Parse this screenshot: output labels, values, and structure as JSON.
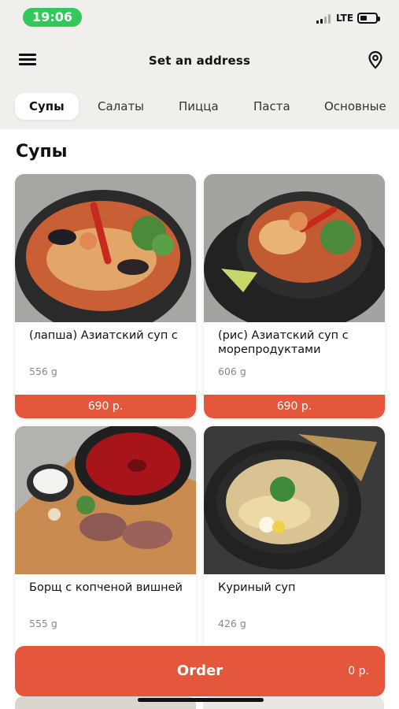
{
  "status_bar": {
    "time": "19:06",
    "network": "LTE",
    "battery_level": 0.45
  },
  "header": {
    "menu_icon": "hamburger-menu-icon",
    "title": "Set an address",
    "location_icon": "location-pin-icon"
  },
  "tabs": [
    {
      "label": "Супы",
      "active": true
    },
    {
      "label": "Салаты",
      "active": false
    },
    {
      "label": "Пицца",
      "active": false
    },
    {
      "label": "Паста",
      "active": false
    },
    {
      "label": "Основные",
      "active": false
    }
  ],
  "section": {
    "title": "Супы"
  },
  "products": [
    {
      "name": "(лапша) Азиатский суп с",
      "weight": "556 g",
      "price": "690 р."
    },
    {
      "name": "(рис) Азиатский суп с морепродуктами",
      "weight": "606 g",
      "price": "690 р."
    },
    {
      "name": "Борщ с копченой вишней",
      "weight": "555 g",
      "price": ""
    },
    {
      "name": "Куриный суп",
      "weight": "426 g",
      "price": ""
    }
  ],
  "order": {
    "label": "Order",
    "total": "0 р."
  },
  "colors": {
    "accent": "#e5573d",
    "background": "#f1efec",
    "status_pill": "#34c759"
  }
}
